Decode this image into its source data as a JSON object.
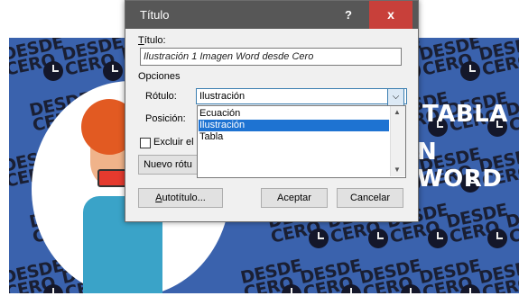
{
  "dialog": {
    "title": "Título",
    "help_label": "?",
    "close_label": "x",
    "caption_label": "Título:",
    "caption_value": "Ilustración 1 Imagen Word desde Cero",
    "options_label": "Opciones",
    "label_label": "Rótulo:",
    "label_value": "Ilustración",
    "position_label": "Posición:",
    "exclude_label": "Excluir el",
    "new_label_button": "Nuevo rótu",
    "autocaption_button": "Autotítulo...",
    "ok_button": "Aceptar",
    "cancel_button": "Cancelar",
    "dropdown_items": [
      "Ecuación",
      "Ilustración",
      "Tabla"
    ],
    "selected_index": 1
  },
  "background": {
    "watermark_text": "DESDE CERO",
    "headline_1": "TABLA",
    "headline_2": "N WORD",
    "brand_color": "#3a62ad"
  }
}
